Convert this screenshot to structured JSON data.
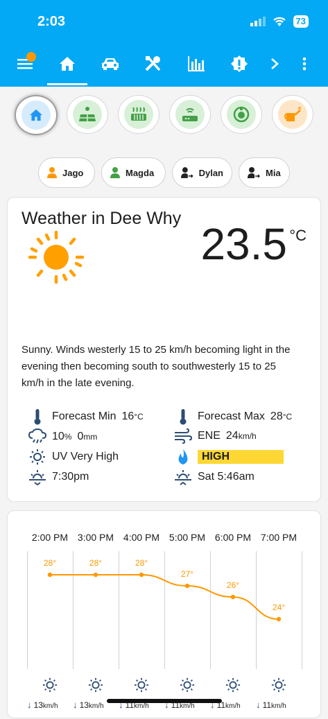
{
  "status_bar": {
    "time": "2:03",
    "battery": "73"
  },
  "nav": {
    "icons": [
      "menu-icon",
      "home-icon",
      "car-icon",
      "tools-icon",
      "chart-icon",
      "alert-icon",
      "chevron-right-icon",
      "more-icon"
    ],
    "active": "home"
  },
  "rooms": [
    {
      "name": "home",
      "bg": "#d6ebfb",
      "color": "#2196f3",
      "active": true
    },
    {
      "name": "solar",
      "bg": "#d8f0d8",
      "color": "#43a047"
    },
    {
      "name": "heater",
      "bg": "#d8f0d8",
      "color": "#43a047"
    },
    {
      "name": "router",
      "bg": "#d8f0d8",
      "color": "#43a047"
    },
    {
      "name": "robot",
      "bg": "#d8f0d8",
      "color": "#43a047"
    },
    {
      "name": "watering",
      "bg": "#fde6c8",
      "color": "#ff9800"
    }
  ],
  "people": [
    {
      "name": "Jago",
      "status": "home",
      "color": "#ff9800"
    },
    {
      "name": "Magda",
      "status": "home",
      "color": "#43a047"
    },
    {
      "name": "Dylan",
      "status": "away",
      "color": "#212121"
    },
    {
      "name": "Mia",
      "status": "away",
      "color": "#212121"
    }
  ],
  "weather": {
    "title": "Weather in Dee Why",
    "temp": "23.5",
    "temp_unit": "°C",
    "description": "Sunny. Winds westerly 15 to 25 km/h becoming light in the evening then becoming south to southwesterly 15 to 25 km/h in the late evening.",
    "forecast_min_label": "Forecast Min",
    "forecast_min_value": "16",
    "forecast_max_label": "Forecast Max",
    "forecast_max_value": "28",
    "deg_unit": "°C",
    "rain_chance": "10",
    "rain_pct_unit": "%",
    "rain_amount": "0",
    "rain_unit": "mm",
    "wind_dir": "ENE",
    "wind_speed": "24",
    "wind_unit": "km/h",
    "uv": "UV Very High",
    "fire_danger": "HIGH",
    "sunset": "7:30pm",
    "sunrise": "Sat 5:46am"
  },
  "chart_data": {
    "type": "line",
    "categories": [
      "2:00 PM",
      "3:00 PM",
      "4:00 PM",
      "5:00 PM",
      "6:00 PM",
      "7:00 PM"
    ],
    "values": [
      28,
      28,
      28,
      27,
      26,
      24
    ],
    "value_labels": [
      "28°",
      "28°",
      "28°",
      "27°",
      "26°",
      "24°"
    ],
    "ylim": [
      20,
      30
    ],
    "series_color": "#ff9800",
    "wind": [
      {
        "speed": "13",
        "unit": "km/h"
      },
      {
        "speed": "13",
        "unit": "km/h"
      },
      {
        "speed": "11",
        "unit": "km/h"
      },
      {
        "speed": "11",
        "unit": "km/h"
      },
      {
        "speed": "11",
        "unit": "km/h"
      },
      {
        "speed": "11",
        "unit": "km/h"
      }
    ]
  }
}
